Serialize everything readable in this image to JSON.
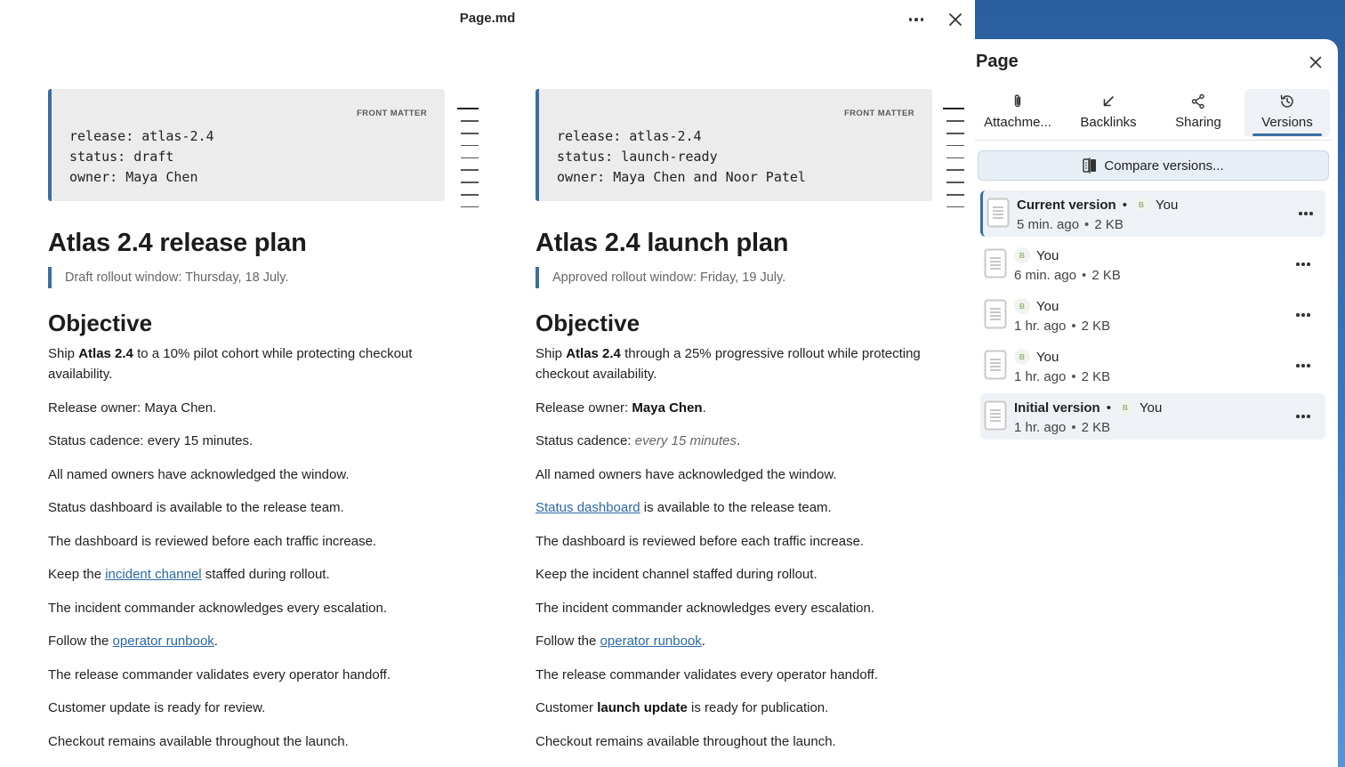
{
  "window": {
    "title": "Page.md",
    "more_icon": "more-horizontal-icon",
    "close_icon": "close-icon"
  },
  "left_pane": {
    "frontmatter_label": "FRONT MATTER",
    "frontmatter_lines": [
      "release: atlas-2.4",
      "status: draft",
      "owner: Maya Chen"
    ],
    "title": "Atlas 2.4 release plan",
    "quote": "Draft rollout window: Thursday, 18 July.",
    "heading": "Objective",
    "p1_a": "Ship ",
    "p1_b": "Atlas 2.4",
    "p1_c": " to a 10% pilot cohort while protecting checkout availability.",
    "p2": "Release owner: Maya Chen.",
    "p3": "Status cadence: every 15 minutes.",
    "p4": "All named owners have acknowledged the window.",
    "p5": "Status dashboard is available to the release team.",
    "p6": "The dashboard is reviewed before each traffic increase.",
    "p7_a": "Keep the ",
    "p7_link": "incident channel",
    "p7_c": " staffed during rollout.",
    "p8": "The incident commander acknowledges every escalation.",
    "p9_a": "Follow the ",
    "p9_link": "operator runbook",
    "p9_c": ".",
    "p10": "The release commander validates every operator handoff.",
    "p11": "Customer update is ready for review.",
    "p12": "Checkout remains available throughout the launch."
  },
  "right_pane": {
    "frontmatter_label": "FRONT MATTER",
    "frontmatter_lines": [
      "release: atlas-2.4",
      "status: launch-ready",
      "owner: Maya Chen and Noor Patel"
    ],
    "title": "Atlas 2.4 launch plan",
    "quote": "Approved rollout window: Friday, 19 July.",
    "heading": "Objective",
    "p1_a": "Ship ",
    "p1_b": "Atlas 2.4",
    "p1_c": " through a 25% progressive rollout while protecting checkout availability.",
    "p2_a": "Release owner: ",
    "p2_b": "Maya Chen",
    "p2_c": ".",
    "p3_a": "Status cadence: ",
    "p3_b": "every 15 minutes",
    "p3_c": ".",
    "p4": "All named owners have acknowledged the window.",
    "p5_link": "Status dashboard",
    "p5_c": " is available to the release team.",
    "p6": "The dashboard is reviewed before each traffic increase.",
    "p7": "Keep the incident channel staffed during rollout.",
    "p8": "The incident commander acknowledges every escalation.",
    "p9_a": "Follow the ",
    "p9_link": "operator runbook",
    "p9_c": ".",
    "p10": "The release commander validates every operator handoff.",
    "p11_a": "Customer ",
    "p11_b": "launch update",
    "p11_c": " is ready for publication.",
    "p12": "Checkout remains available throughout the launch."
  },
  "panel": {
    "title": "Page",
    "tabs": [
      {
        "label": "Attachme...",
        "icon": "paperclip-icon"
      },
      {
        "label": "Backlinks",
        "icon": "arrow-down-left-icon"
      },
      {
        "label": "Sharing",
        "icon": "share-icon"
      },
      {
        "label": "Versions",
        "icon": "history-icon"
      }
    ],
    "active_tab": "Versions",
    "compare_label": "Compare versions...",
    "versions": [
      {
        "name": "Current version",
        "avatar": "B",
        "author": "You",
        "time": "5 min. ago",
        "size": "2 KB"
      },
      {
        "name": "",
        "avatar": "B",
        "author": "You",
        "time": "6 min. ago",
        "size": "2 KB"
      },
      {
        "name": "",
        "avatar": "B",
        "author": "You",
        "time": "1 hr. ago",
        "size": "2 KB"
      },
      {
        "name": "",
        "avatar": "B",
        "author": "You",
        "time": "1 hr. ago",
        "size": "2 KB"
      },
      {
        "name": "Initial version",
        "avatar": "B",
        "author": "You",
        "time": "1 hr. ago",
        "size": "2 KB"
      }
    ],
    "separator": "•"
  },
  "colors": {
    "accent": "#3a6ea5",
    "link": "#2a69a8",
    "frontmatter_bg": "#ececec",
    "desktop": "#3b78bf"
  }
}
